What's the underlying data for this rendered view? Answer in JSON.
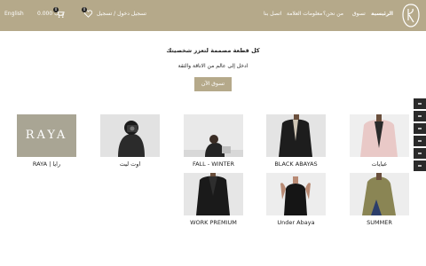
{
  "header": {
    "lang": "English",
    "cart_total": "0.000 د.ب",
    "cart_count": "0",
    "wishlist_count": "0",
    "login": "تسجيل دخول / تسجيل",
    "nav": {
      "contact": "اتصل بنا",
      "info": "معلومات العلامة",
      "about": "من نحن؟",
      "shop": "تسوق",
      "home": "الرئيسية"
    }
  },
  "hero": {
    "title": "كل قطعة مصممة لتعزز شخصيتك",
    "subtitle": "ادخل إلى عالم من الاناقة والثقة",
    "button": "تسوق الآن"
  },
  "categories": [
    {
      "label": "RAYA | رايا"
    },
    {
      "label": "اوت ليت"
    },
    {
      "label": "FALL - WINTER"
    },
    {
      "label": "BLACK ABAYAS"
    },
    {
      "label": "عبايات"
    },
    {
      "label": "WORK PREMIUM"
    },
    {
      "label": "Under Abaya"
    },
    {
      "label": "SUMMER"
    }
  ],
  "raya_logo_text": "RAYA",
  "colors": {
    "header": "#b5a98a",
    "button": "#b5a98a",
    "side_tab": "#2a2a2a"
  }
}
